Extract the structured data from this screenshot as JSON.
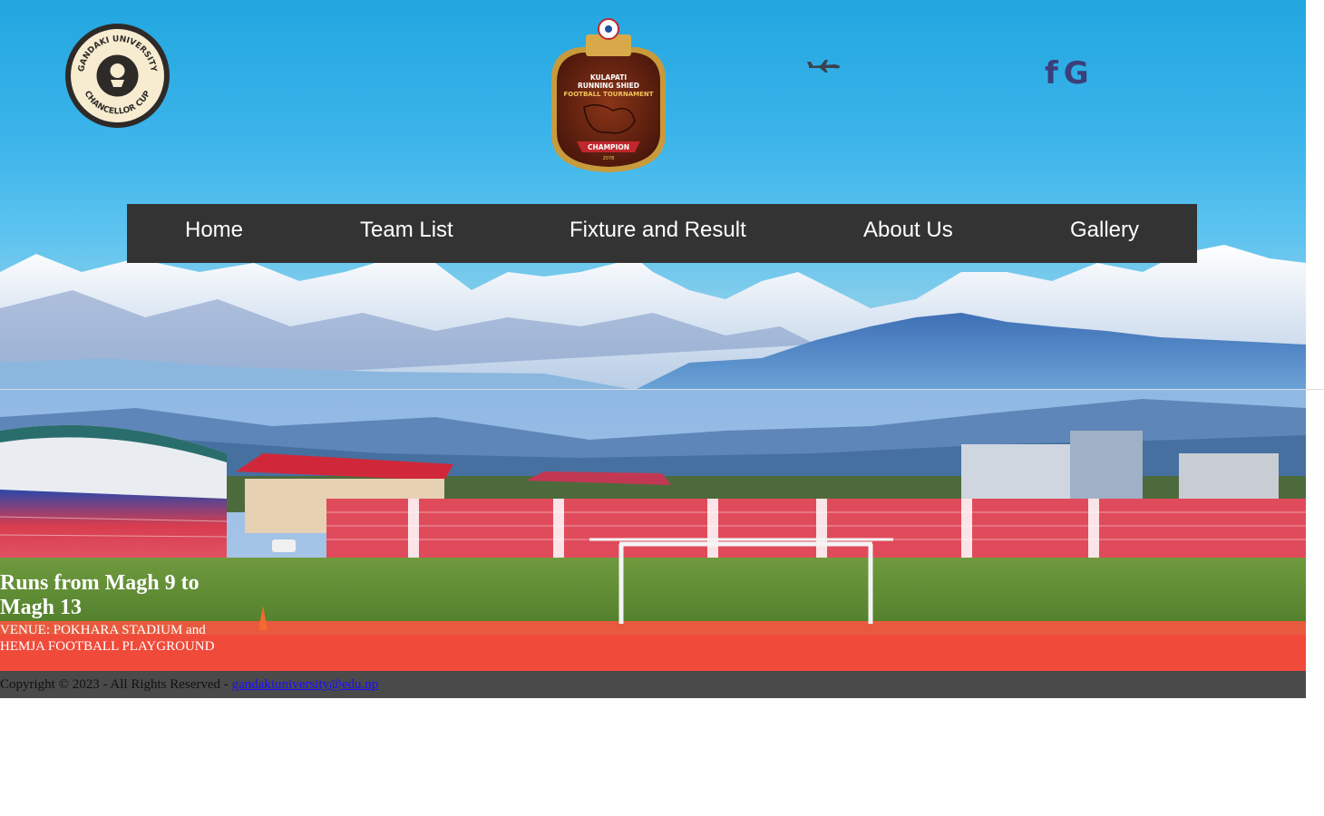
{
  "header": {
    "left_logo": {
      "ring_text_top": "GANDAKI UNIVERSITY",
      "ring_text_bottom": "CHANCELLOR CUP"
    },
    "center_logo": {
      "line1": "KULAPATI",
      "line2": "RUNNING SHIED",
      "line3": "FOOTBALL TOURNAMENT",
      "ribbon": "CHAMPION",
      "year": "2078"
    },
    "social": [
      {
        "icon": "facebook-icon",
        "glyph": "f"
      },
      {
        "icon": "google-icon",
        "glyph": "G"
      }
    ]
  },
  "nav": {
    "items": [
      {
        "label": "Home"
      },
      {
        "label": "Team List"
      },
      {
        "label": "Fixture and Result"
      },
      {
        "label": "About Us"
      },
      {
        "label": "Gallery"
      }
    ]
  },
  "event": {
    "dates": "Runs from Magh 9 to Magh 13",
    "venue": "VENUE: POKHARA STADIUM and HEMJA FOOTBALL PLAYGROUND"
  },
  "footer": {
    "copyright": "Copyright © 2023 - All Rights Reserved - ",
    "email": "gandakiuniversity@edu.np"
  },
  "colors": {
    "nav_bg": "#333333",
    "footer_bg": "#4a4a4a",
    "sky": "#2aa8e2",
    "link": "#1a0dff"
  }
}
